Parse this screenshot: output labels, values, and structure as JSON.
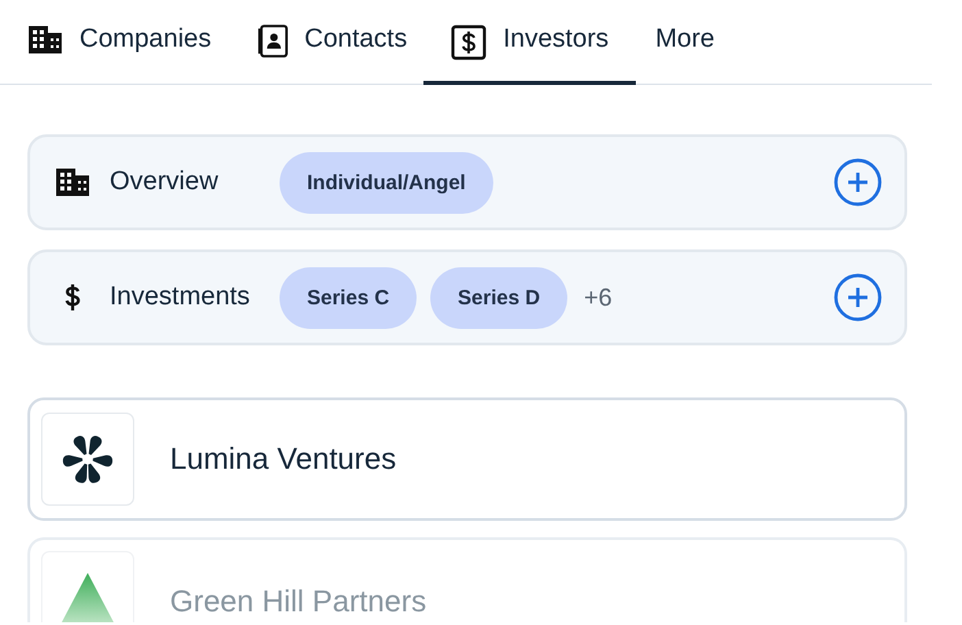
{
  "tabs": [
    {
      "label": "Companies",
      "selected": false
    },
    {
      "label": "Contacts",
      "selected": false
    },
    {
      "label": "Investors",
      "selected": true
    },
    {
      "label": "More",
      "selected": false
    }
  ],
  "filters": [
    {
      "label": "Overview",
      "chips": [
        "Individual/Angel"
      ]
    },
    {
      "label": "Investments",
      "chips": [
        "Series C",
        "Series D"
      ],
      "more": "+6"
    }
  ],
  "results": [
    {
      "name": "Lumina Ventures",
      "faded": false
    },
    {
      "name": "Green Hill Partners",
      "faded": true
    }
  ]
}
